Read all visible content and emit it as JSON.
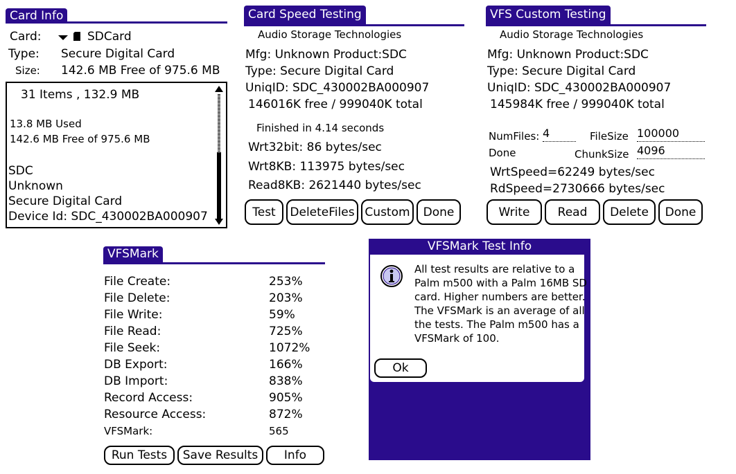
{
  "card_info": {
    "title": "Card Info",
    "card_label": "Card:",
    "card_value": "SDCard",
    "type_label": "Type:",
    "type_value": "Secure Digital Card",
    "size_label": "Size:",
    "size_value": "142.6 MB Free of 975.6 MB",
    "list": {
      "items_summary": "31 Items , 132.9 MB",
      "used": "13.8 MB Used",
      "free": "142.6 MB Free of 975.6 MB",
      "product": "SDC",
      "manufacturer": "Unknown",
      "card_type": "Secure Digital Card",
      "device_id": "Device Id: SDC_430002BA000907"
    }
  },
  "card_speed": {
    "title": "Card Speed Testing",
    "vendor": "Audio Storage Technologies",
    "mfg_product": "Mfg: Unknown  Product:SDC",
    "type": "Type: Secure Digital Card",
    "uniq_id": "UniqID: SDC_430002BA000907",
    "capacity": "146016K free / 999040K total",
    "finished": "Finished in 4.14 seconds",
    "wrt32": "Wrt32bit: 86 bytes/sec",
    "wrt8kb": "Wrt8KB: 113975 bytes/sec",
    "read8kb": "Read8KB: 2621440 bytes/sec",
    "buttons": {
      "test": "Test",
      "delete_files": "DeleteFiles",
      "custom": "Custom",
      "done": "Done"
    }
  },
  "vfs_custom": {
    "title": "VFS Custom Testing",
    "vendor": "Audio Storage Technologies",
    "mfg_product": "Mfg: Unknown  Product:SDC",
    "type": "Type: Secure Digital Card",
    "uniq_id": "UniqID: SDC_430002BA000907",
    "capacity": "145984K free / 999040K total",
    "numfiles_label": "NumFiles:",
    "numfiles_value": "4",
    "filesize_label": "FileSize",
    "filesize_value": "100000",
    "status": "Done",
    "chunksize_label": "ChunkSize",
    "chunksize_value": "4096",
    "wrt_speed": "WrtSpeed=62249 bytes/sec",
    "rd_speed": "RdSpeed=2730666 bytes/sec",
    "buttons": {
      "write": "Write",
      "read": "Read",
      "delete": "Delete",
      "done": "Done"
    }
  },
  "vfsmark": {
    "title": "VFSMark",
    "rows": [
      {
        "label": "File Create:",
        "value": "253%"
      },
      {
        "label": "File Delete:",
        "value": "203%"
      },
      {
        "label": "File Write:",
        "value": "59%"
      },
      {
        "label": "File Read:",
        "value": "725%"
      },
      {
        "label": "File Seek:",
        "value": "1072%"
      },
      {
        "label": "DB Export:",
        "value": "166%"
      },
      {
        "label": "DB Import:",
        "value": "838%"
      },
      {
        "label": "Record Access:",
        "value": "905%"
      },
      {
        "label": "Resource Access:",
        "value": "872%"
      },
      {
        "label": "VFSMark:",
        "value": "565"
      }
    ],
    "buttons": {
      "run_tests": "Run Tests",
      "save_results": "Save Results",
      "info": "Info"
    }
  },
  "info_dialog": {
    "title": "VFSMark Test Info",
    "message_lines": [
      "All test results are relative to a",
      "Palm m500 with a Palm 16MB SD",
      "card. Higher numbers are better.",
      "The VFSMark is an average of all",
      "the tests. The Palm m500 has a",
      "VFSMark of 100."
    ],
    "ok_label": "Ok"
  },
  "colors": {
    "accent": "#2a0c8c",
    "background": "#ffffff",
    "text": "#000000"
  },
  "icons": [
    "dropdown-arrow-icon",
    "sd-card-icon",
    "scroll-up-icon",
    "scroll-down-icon",
    "info-icon"
  ]
}
